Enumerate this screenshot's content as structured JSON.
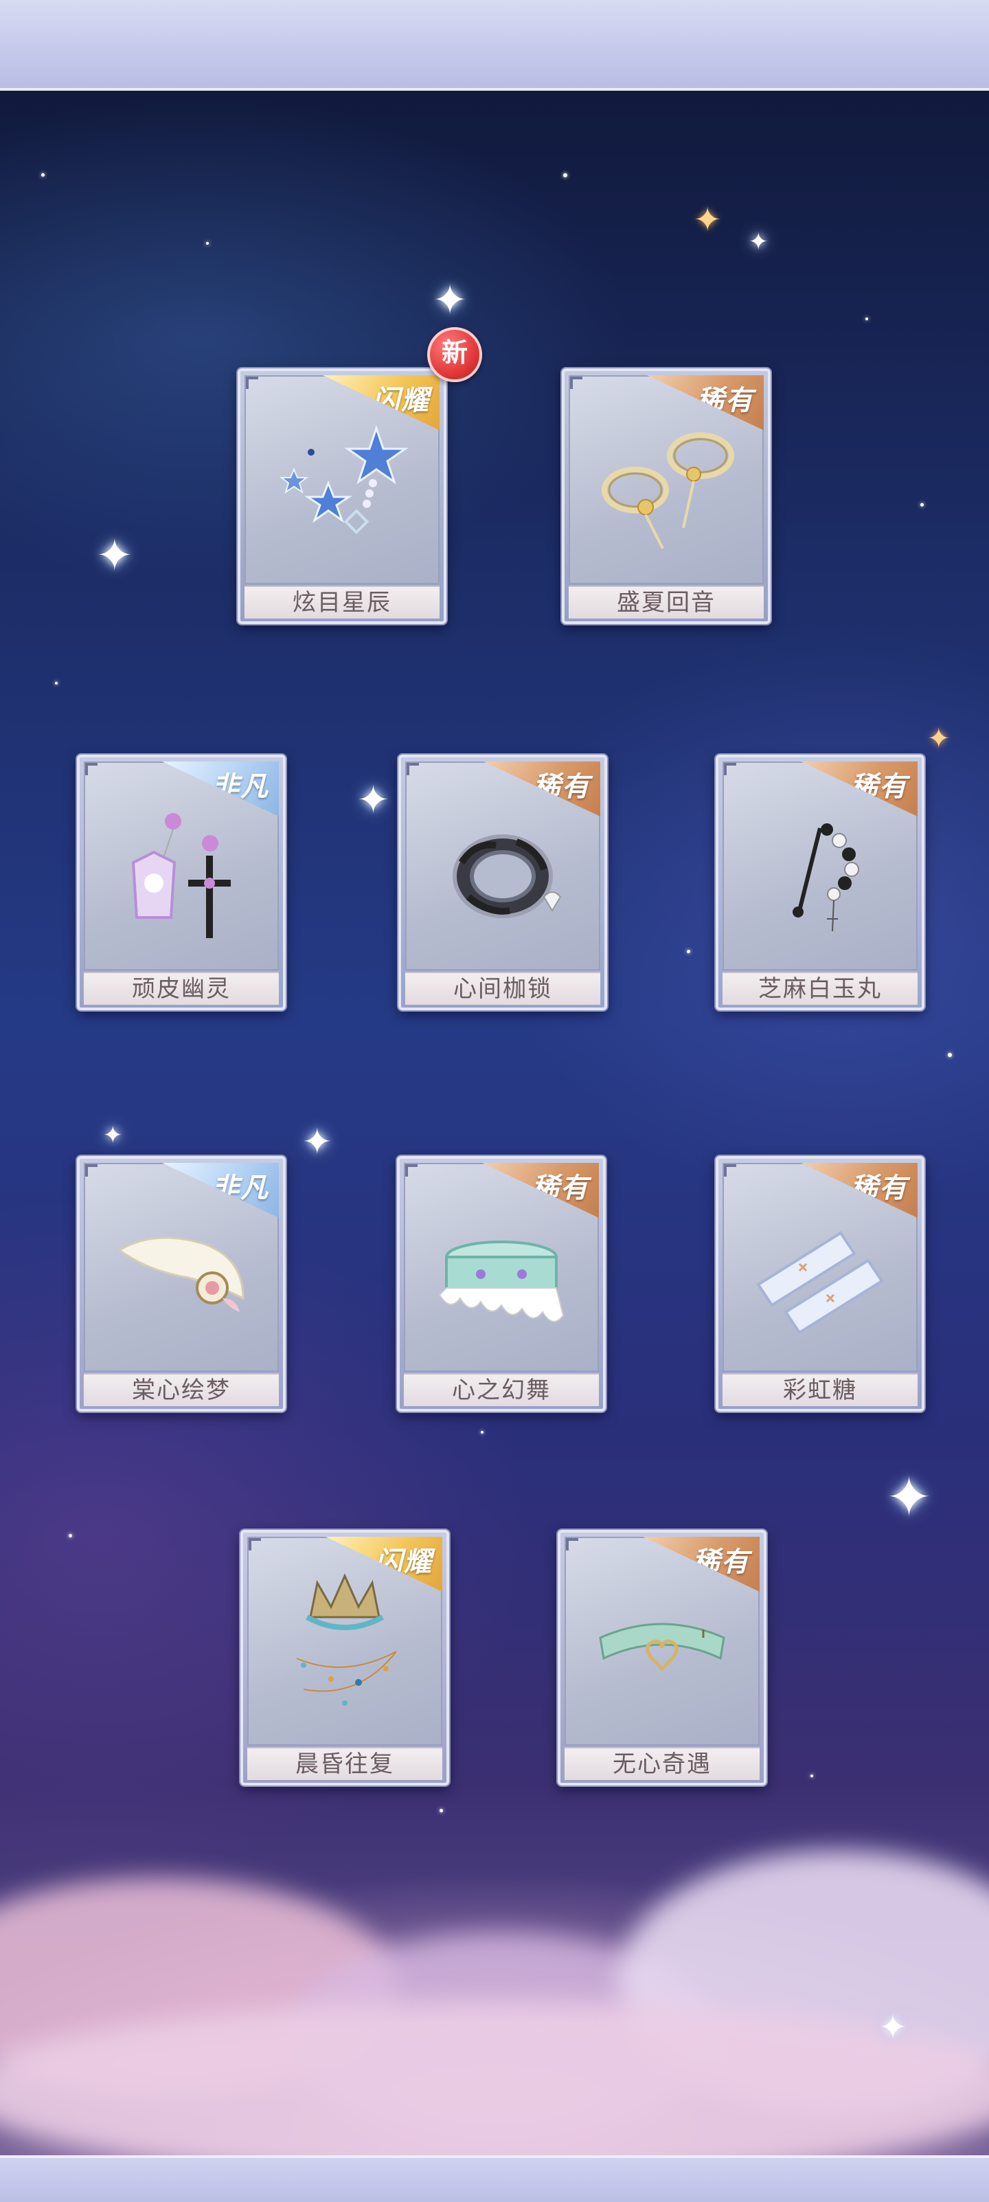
{
  "new_badge": "新",
  "items": [
    {
      "name": "炫目星辰",
      "rarity": "闪耀",
      "rarity_color": "#f4c75b",
      "icon": "star-earring-icon",
      "is_new": true
    },
    {
      "name": "盛夏回音",
      "rarity": "稀有",
      "rarity_color": "#d99a6a",
      "icon": "ring-bracelet-icon"
    },
    {
      "name": "顽皮幽灵",
      "rarity": "非凡",
      "rarity_color": "#b4d3f5",
      "icon": "coffin-cross-earring-icon"
    },
    {
      "name": "心间枷锁",
      "rarity": "稀有",
      "rarity_color": "#d99a6a",
      "icon": "chain-bracelet-icon"
    },
    {
      "name": "芝麻白玉丸",
      "rarity": "稀有",
      "rarity_color": "#d99a6a",
      "icon": "bead-hairpin-icon"
    },
    {
      "name": "棠心绘梦",
      "rarity": "非凡",
      "rarity_color": "#b4d3f5",
      "icon": "beret-icon"
    },
    {
      "name": "心之幻舞",
      "rarity": "稀有",
      "rarity_color": "#d99a6a",
      "icon": "ruffle-cuff-icon"
    },
    {
      "name": "彩虹糖",
      "rarity": "稀有",
      "rarity_color": "#d99a6a",
      "icon": "arm-sleeves-icon"
    },
    {
      "name": "晨昏往复",
      "rarity": "闪耀",
      "rarity_color": "#f4c75b",
      "icon": "crown-headpiece-icon"
    },
    {
      "name": "无心奇遇",
      "rarity": "稀有",
      "rarity_color": "#d99a6a",
      "icon": "heart-choker-icon"
    }
  ]
}
